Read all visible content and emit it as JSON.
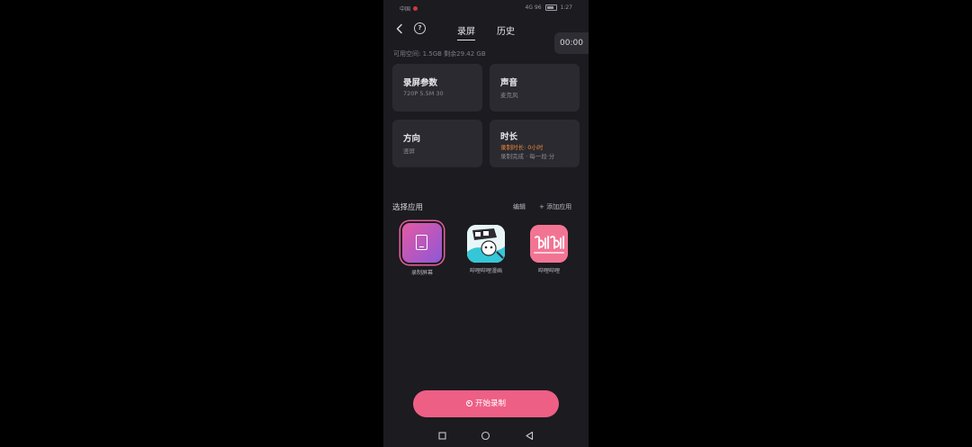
{
  "status_bar": {
    "left_text": "中国",
    "right_text": "4G 96",
    "time": "1:27"
  },
  "header": {
    "tabs": [
      {
        "label": "录屏",
        "active": true
      },
      {
        "label": "历史",
        "active": false
      }
    ]
  },
  "timer": "00:00",
  "storage": "可用空间: 1.5GB  剩余29.42 GB",
  "cards": {
    "params": {
      "title": "录屏参数",
      "subtitle": "720P  5.5M  30"
    },
    "audio": {
      "title": "声音",
      "subtitle": "麦克风"
    },
    "orientation": {
      "title": "方向",
      "subtitle": "竖屏"
    },
    "duration": {
      "title": "时长",
      "warning": "录制时长: 0小时",
      "subtitle": "录制完成 · 每一段·分"
    }
  },
  "select_apps": {
    "title": "选择应用",
    "edit": "编辑",
    "add": "+ 添加应用",
    "apps": [
      {
        "name": "录制屏幕",
        "icon": "tablet-icon",
        "selected": true
      },
      {
        "name": "哔哩哔哩漫画",
        "icon": "comic-app-icon",
        "selected": false
      },
      {
        "name": "哔哩哔哩",
        "icon": "bilibili-icon",
        "selected": false
      }
    ]
  },
  "start_button": "开始录制",
  "colors": {
    "background": "#1b1b20",
    "card": "#2a2a30",
    "accent": "#ee5f86",
    "warning": "#e8873a"
  }
}
